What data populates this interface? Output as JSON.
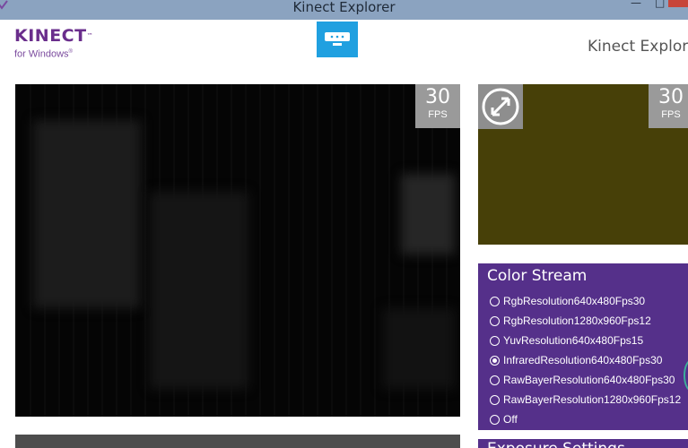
{
  "window": {
    "title": "Kinect Explorer",
    "controls": {
      "minimize": "—",
      "maximize": "□"
    }
  },
  "header": {
    "logo_main": "KINECT",
    "logo_tm": "™",
    "logo_sub": "for Windows",
    "logo_sub_tm": "®",
    "app_title": "Kinect Explorer"
  },
  "main_view": {
    "fps_value": "30",
    "fps_unit": "FPS"
  },
  "secondary_view": {
    "fps_value": "30",
    "fps_unit": "FPS",
    "background_color": "#474008"
  },
  "color_stream": {
    "title": "Color Stream",
    "selected_value": "InfraredResolution640x480Fps30",
    "options": [
      {
        "label": "RgbResolution640x480Fps30",
        "checked": false
      },
      {
        "label": "RgbResolution1280x960Fps12",
        "checked": false
      },
      {
        "label": "YuvResolution640x480Fps15",
        "checked": false
      },
      {
        "label": "InfraredResolution640x480Fps30",
        "checked": true
      },
      {
        "label": "RawBayerResolution640x480Fps30",
        "checked": false
      },
      {
        "label": "RawBayerResolution1280x960Fps12",
        "checked": false
      },
      {
        "label": "Off",
        "checked": false
      }
    ]
  },
  "next_panel": {
    "title": "Exposure Settings"
  },
  "colors": {
    "accent_purple": "#55308a",
    "tile_blue": "#20a0e0",
    "titlebar": "#8ba3c0"
  }
}
